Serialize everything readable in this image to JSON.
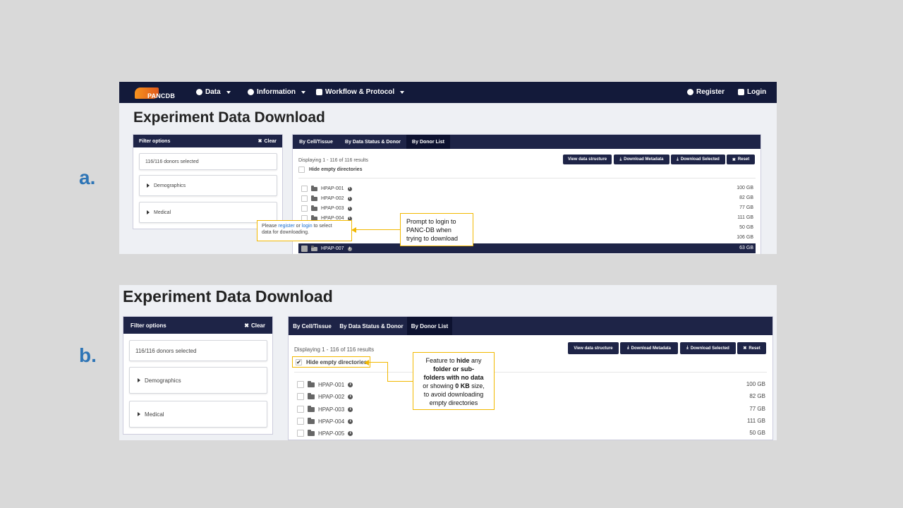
{
  "labels": {
    "a": "a.",
    "b": "b."
  },
  "navbar": {
    "logo_text": "PANCDB",
    "items": [
      {
        "label": "Data",
        "icon": "database-icon"
      },
      {
        "label": "Information",
        "icon": "info-icon"
      },
      {
        "label": "Workflow & Protocol",
        "icon": "factory-icon"
      }
    ],
    "register": "Register",
    "login": "Login"
  },
  "page_title": "Experiment Data Download",
  "filter": {
    "title": "Filter options",
    "clear": "Clear",
    "donors_selected": "116/116 donors selected",
    "demographics": "Demographics",
    "medical": "Medical"
  },
  "tabs": [
    "By Cell/Tissue",
    "By Data Status & Donor",
    "By Donor List"
  ],
  "results_text": "Displaying 1 - 116 of 116 results",
  "hide_empty": "Hide empty directories",
  "buttons": {
    "view_structure": "View data structure",
    "download_metadata": "Download Metadata",
    "download_selected": "Download Selected",
    "reset": "Reset"
  },
  "rows_a": [
    {
      "name": "HPAP-001",
      "size": "100 GB"
    },
    {
      "name": "HPAP-002",
      "size": "82 GB"
    },
    {
      "name": "HPAP-003",
      "size": "77 GB"
    },
    {
      "name": "HPAP-004",
      "size": "111 GB"
    },
    {
      "name": "",
      "size": "50 GB"
    },
    {
      "name": "",
      "size": "106 GB"
    },
    {
      "name": "HPAP-007",
      "size": "63 GB"
    }
  ],
  "rows_b": [
    {
      "name": "HPAP-001",
      "size": "100 GB"
    },
    {
      "name": "HPAP-002",
      "size": "82 GB"
    },
    {
      "name": "HPAP-003",
      "size": "77 GB"
    },
    {
      "name": "HPAP-004",
      "size": "111 GB"
    },
    {
      "name": "HPAP-005",
      "size": "50 GB"
    }
  ],
  "tooltip": {
    "please": "Please",
    "register": "register",
    "or": "or",
    "login": "login",
    "rest": "to select",
    "line2": "data for downloading."
  },
  "callout_a": [
    "Prompt to login to",
    "PANC-DB when",
    "trying to download"
  ],
  "callout_b": {
    "l1a": "Feature to ",
    "l1b": "hide",
    "l1c": " any",
    "l2": "folder or sub-",
    "l3": "folders with no data",
    "l4a": "or showing ",
    "l4b": "0 KB",
    "l4c": " size,",
    "l5": "to avoid downloading",
    "l6": "empty directories"
  },
  "colors": {
    "navy": "#131a3a",
    "accent": "#f2b800",
    "letter": "#2e75b6"
  }
}
